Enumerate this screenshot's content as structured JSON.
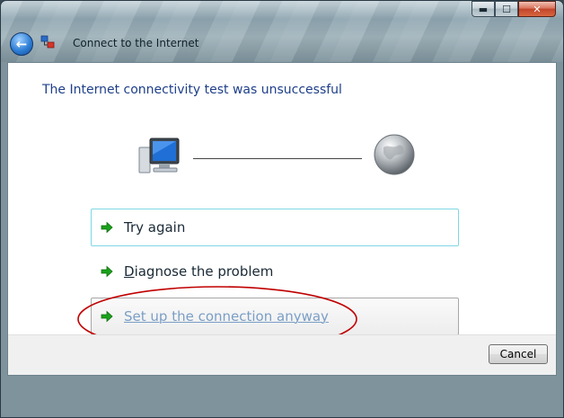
{
  "window": {
    "title": "Connect to the Internet",
    "caption_buttons": {
      "minimize": "▬",
      "maximize": "☐",
      "close": "✕"
    }
  },
  "content": {
    "heading": "The Internet connectivity test was unsuccessful",
    "options": [
      {
        "label": "Try again",
        "mnemonic": "",
        "rest": ""
      },
      {
        "label": "",
        "mnemonic": "D",
        "rest": "iagnose the problem"
      },
      {
        "label": "",
        "mnemonic": "S",
        "rest": "et up the connection anyway"
      }
    ]
  },
  "footer": {
    "cancel_label": "Cancel"
  },
  "colors": {
    "accent": "#1e3f8a",
    "annotation": "#c00000",
    "arrow": "#1aa21a"
  },
  "icons": {
    "back": "back-arrow-icon",
    "network": "network-icon",
    "computer": "computer-icon",
    "globe": "globe-icon",
    "option_arrow": "green-arrow-icon"
  }
}
